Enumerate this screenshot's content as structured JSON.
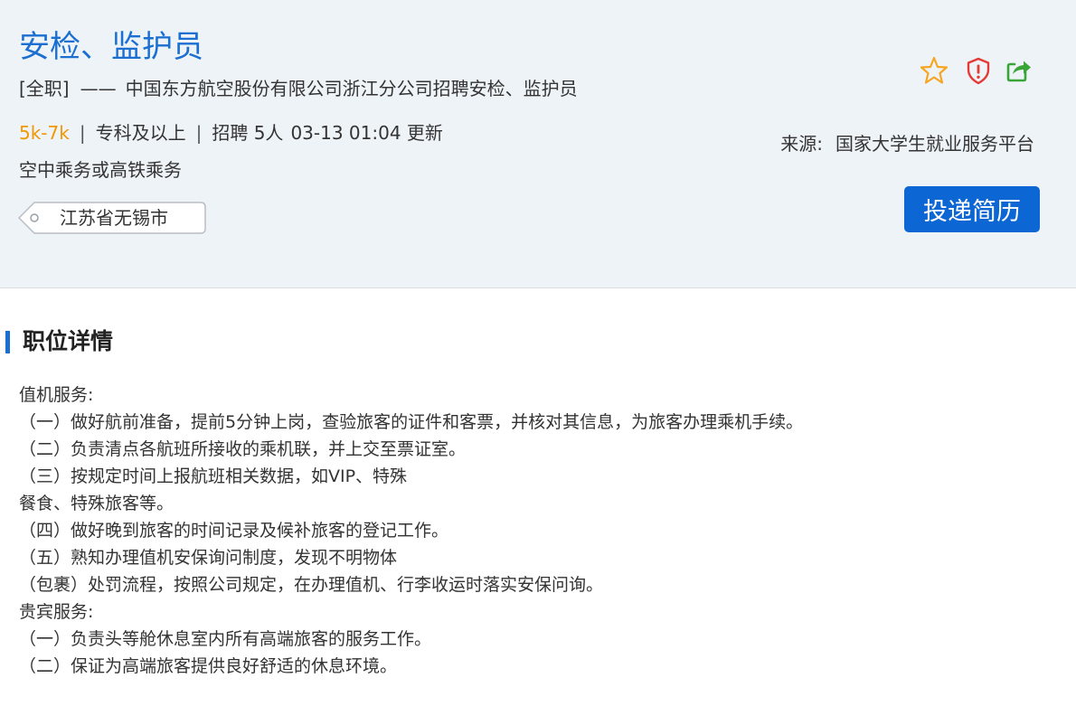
{
  "job": {
    "title": "安检、监护员",
    "type": "[全职]",
    "dash": "——",
    "company": "中国东方航空股份有限公司浙江分公司招聘安检、监护员",
    "salary": "5k-7k",
    "education": "专科及以上",
    "headcount": "招聘 5人",
    "updated": "03-13 01:04 更新",
    "category": "空中乘务或高铁乘务",
    "location": "江苏省无锡市",
    "separator": "|"
  },
  "source": {
    "label": "来源:",
    "value": "国家大学生就业服务平台"
  },
  "actions": {
    "apply_label": "投递简历",
    "icons": [
      "star-icon",
      "shield-alert-icon",
      "share-icon"
    ],
    "colors": {
      "star": "#f5a623",
      "shield": "#e53935",
      "share": "#3aa537"
    }
  },
  "section": {
    "title": "职位详情"
  },
  "description": [
    "值机服务:",
    "（一）做好航前准备，提前5分钟上岗，查验旅客的证件和客票，并核对其信息，为旅客办理乘机手续。",
    "（二）负责清点各航班所接收的乘机联，并上交至票证室。",
    "（三）按规定时间上报航班相关数据，如VIP、特殊",
    "餐食、特殊旅客等。",
    "（四）做好晚到旅客的时间记录及候补旅客的登记工作。",
    "（五）熟知办理值机安保询问制度，发现不明物体",
    "（包裹）处罚流程，按照公司规定，在办理值机、行李收运时落实安保问询。",
    "贵宾服务:",
    "（一）负责头等舱休息室内所有高端旅客的服务工作。",
    "（二）保证为高端旅客提供良好舒适的休息环境。"
  ],
  "theme": {
    "accent": "#1a6fd1",
    "salary": "#f29700",
    "button": "#0c66d4",
    "header_bg": "#eef3f8"
  }
}
